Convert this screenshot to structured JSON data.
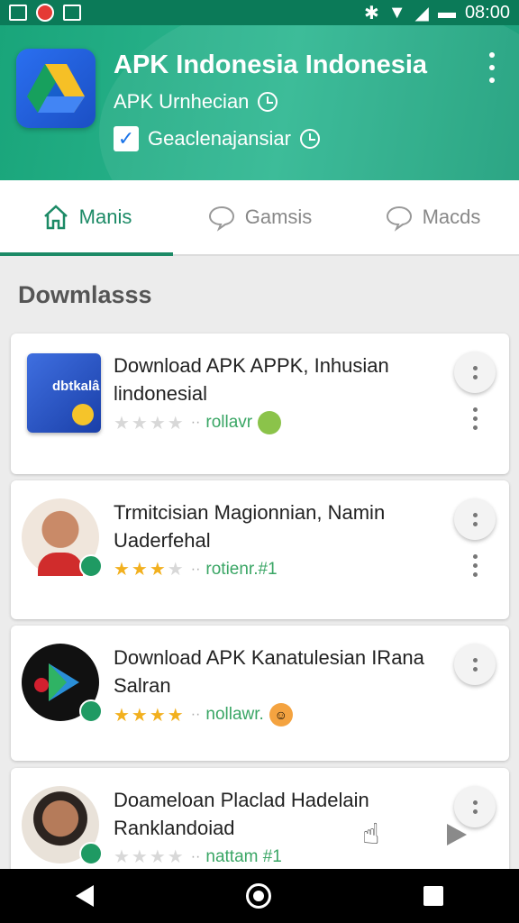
{
  "status_bar": {
    "time": "08:00"
  },
  "header": {
    "title": "APK Indonesia Indonesia",
    "subtitle": "APK Urnhecian",
    "checkbox_label": "Geaclenajansiar"
  },
  "tabs": [
    {
      "label": "Manis",
      "icon": "home-icon",
      "active": true
    },
    {
      "label": "Gamsis",
      "icon": "chat-bubble-icon",
      "active": false
    },
    {
      "label": "Macds",
      "icon": "chat-bubble-icon",
      "active": false
    }
  ],
  "section": {
    "title": "Dowmlasss"
  },
  "items": [
    {
      "title": "Download APK APPK, Inhusian lindonesial",
      "rating": 0,
      "meta": "rollavr",
      "thumb_text": "dbtkalâ"
    },
    {
      "title": "Trmitcisian Magionnian, Namin Uaderfehal",
      "rating": 3.5,
      "meta": "rotienr.#1"
    },
    {
      "title": "Download APK Kanatulesian IRana Salran",
      "rating": 3.5,
      "meta": "nollawr."
    },
    {
      "title": "Doameloan Placlad Hadelain Ranklandoiad",
      "rating": 0,
      "meta": "nattam #1"
    }
  ],
  "colors": {
    "accent": "#1c8a66",
    "header": "#19a57a",
    "star": "#f2b01e"
  }
}
